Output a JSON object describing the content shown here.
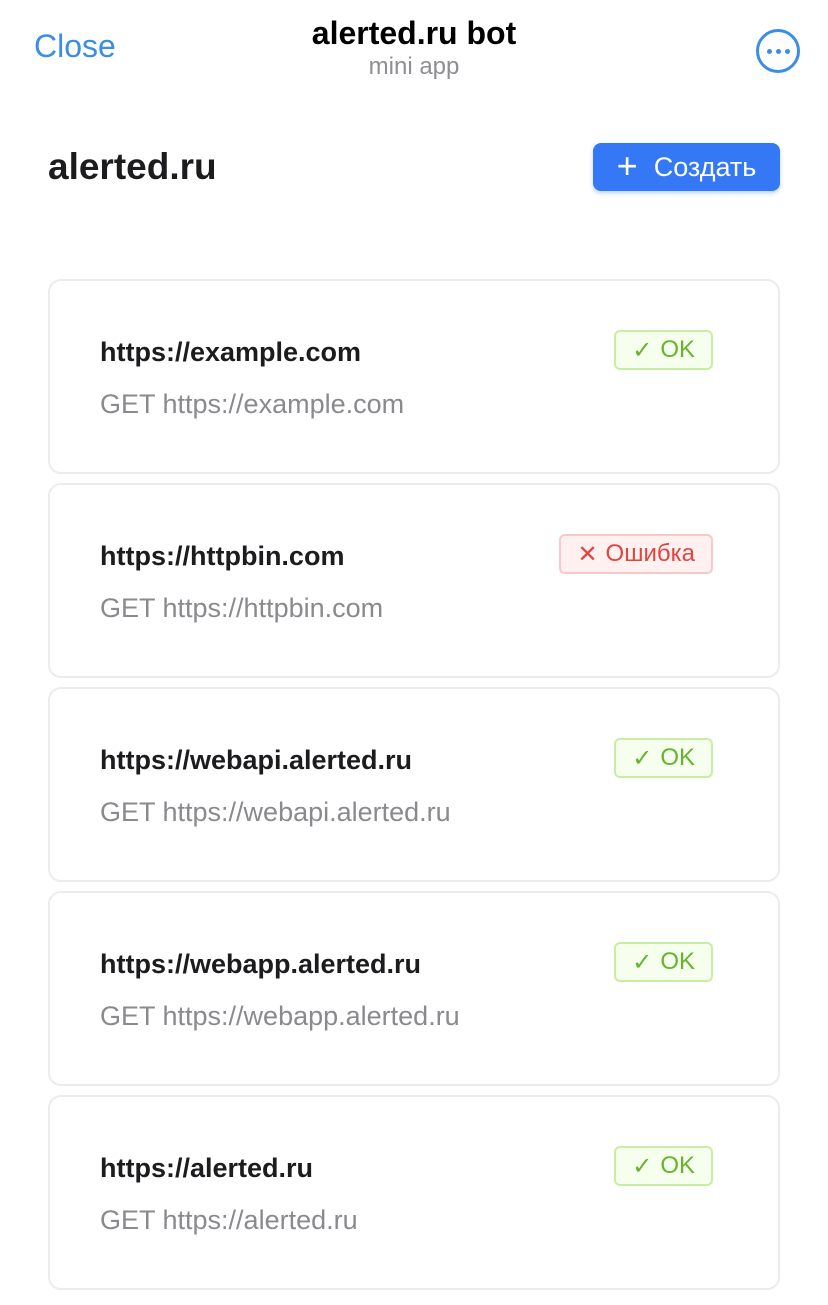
{
  "header": {
    "close_label": "Close",
    "title": "alerted.ru bot",
    "subtitle": "mini app",
    "more_icon": "ellipsis-circle-icon"
  },
  "page": {
    "brand": "alerted.ru",
    "create_icon": "+",
    "create_label": "Создать"
  },
  "colors": {
    "accent": "#3478f6",
    "link": "#3a8ee6",
    "ok_text": "#66b32e",
    "ok_bg": "#f6ffed",
    "error_text": "#e0463f",
    "error_bg": "#fff1f0"
  },
  "monitors": [
    {
      "title": "https://example.com",
      "request": "GET https://example.com",
      "status": "ok",
      "status_icon": "✓",
      "status_label": "OK"
    },
    {
      "title": "https://httpbin.com",
      "request": "GET https://httpbin.com",
      "status": "err",
      "status_icon": "✕",
      "status_label": "Ошибка"
    },
    {
      "title": "https://webapi.alerted.ru",
      "request": "GET https://webapi.alerted.ru",
      "status": "ok",
      "status_icon": "✓",
      "status_label": "OK"
    },
    {
      "title": "https://webapp.alerted.ru",
      "request": "GET https://webapp.alerted.ru",
      "status": "ok",
      "status_icon": "✓",
      "status_label": "OK"
    },
    {
      "title": "https://alerted.ru",
      "request": "GET https://alerted.ru",
      "status": "ok",
      "status_icon": "✓",
      "status_label": "OK"
    }
  ]
}
